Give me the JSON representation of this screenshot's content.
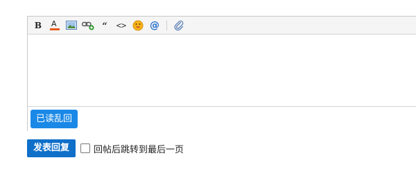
{
  "toolbar": {
    "items": [
      {
        "name": "bold-button",
        "icon": "bold-icon"
      },
      {
        "name": "font-color-button",
        "icon": "font-color-icon"
      },
      {
        "name": "image-button",
        "icon": "image-icon"
      },
      {
        "name": "link-button",
        "icon": "link-add-icon"
      },
      {
        "name": "quote-button",
        "icon": "quote-icon"
      },
      {
        "name": "code-button",
        "icon": "code-icon"
      },
      {
        "name": "emoji-button",
        "icon": "emoji-icon"
      },
      {
        "name": "mention-button",
        "icon": "at-icon"
      },
      {
        "name": "attachment-button",
        "icon": "paperclip-icon"
      }
    ],
    "bold_glyph": "B",
    "font_color_glyph": "A",
    "quote_glyph": "“",
    "code_glyph": "<>",
    "at_glyph": "@",
    "font_color_underline": "#e85a1c"
  },
  "editor": {
    "content": "",
    "quick_reply_label": "已读乱回"
  },
  "actions": {
    "submit_label": "发表回复",
    "jump_last_page_label": "回帖后跳转到最后一页",
    "jump_last_page_checked": false
  },
  "colors": {
    "primary_button": "#1a88e6",
    "submit_button": "#0f6fc9"
  }
}
